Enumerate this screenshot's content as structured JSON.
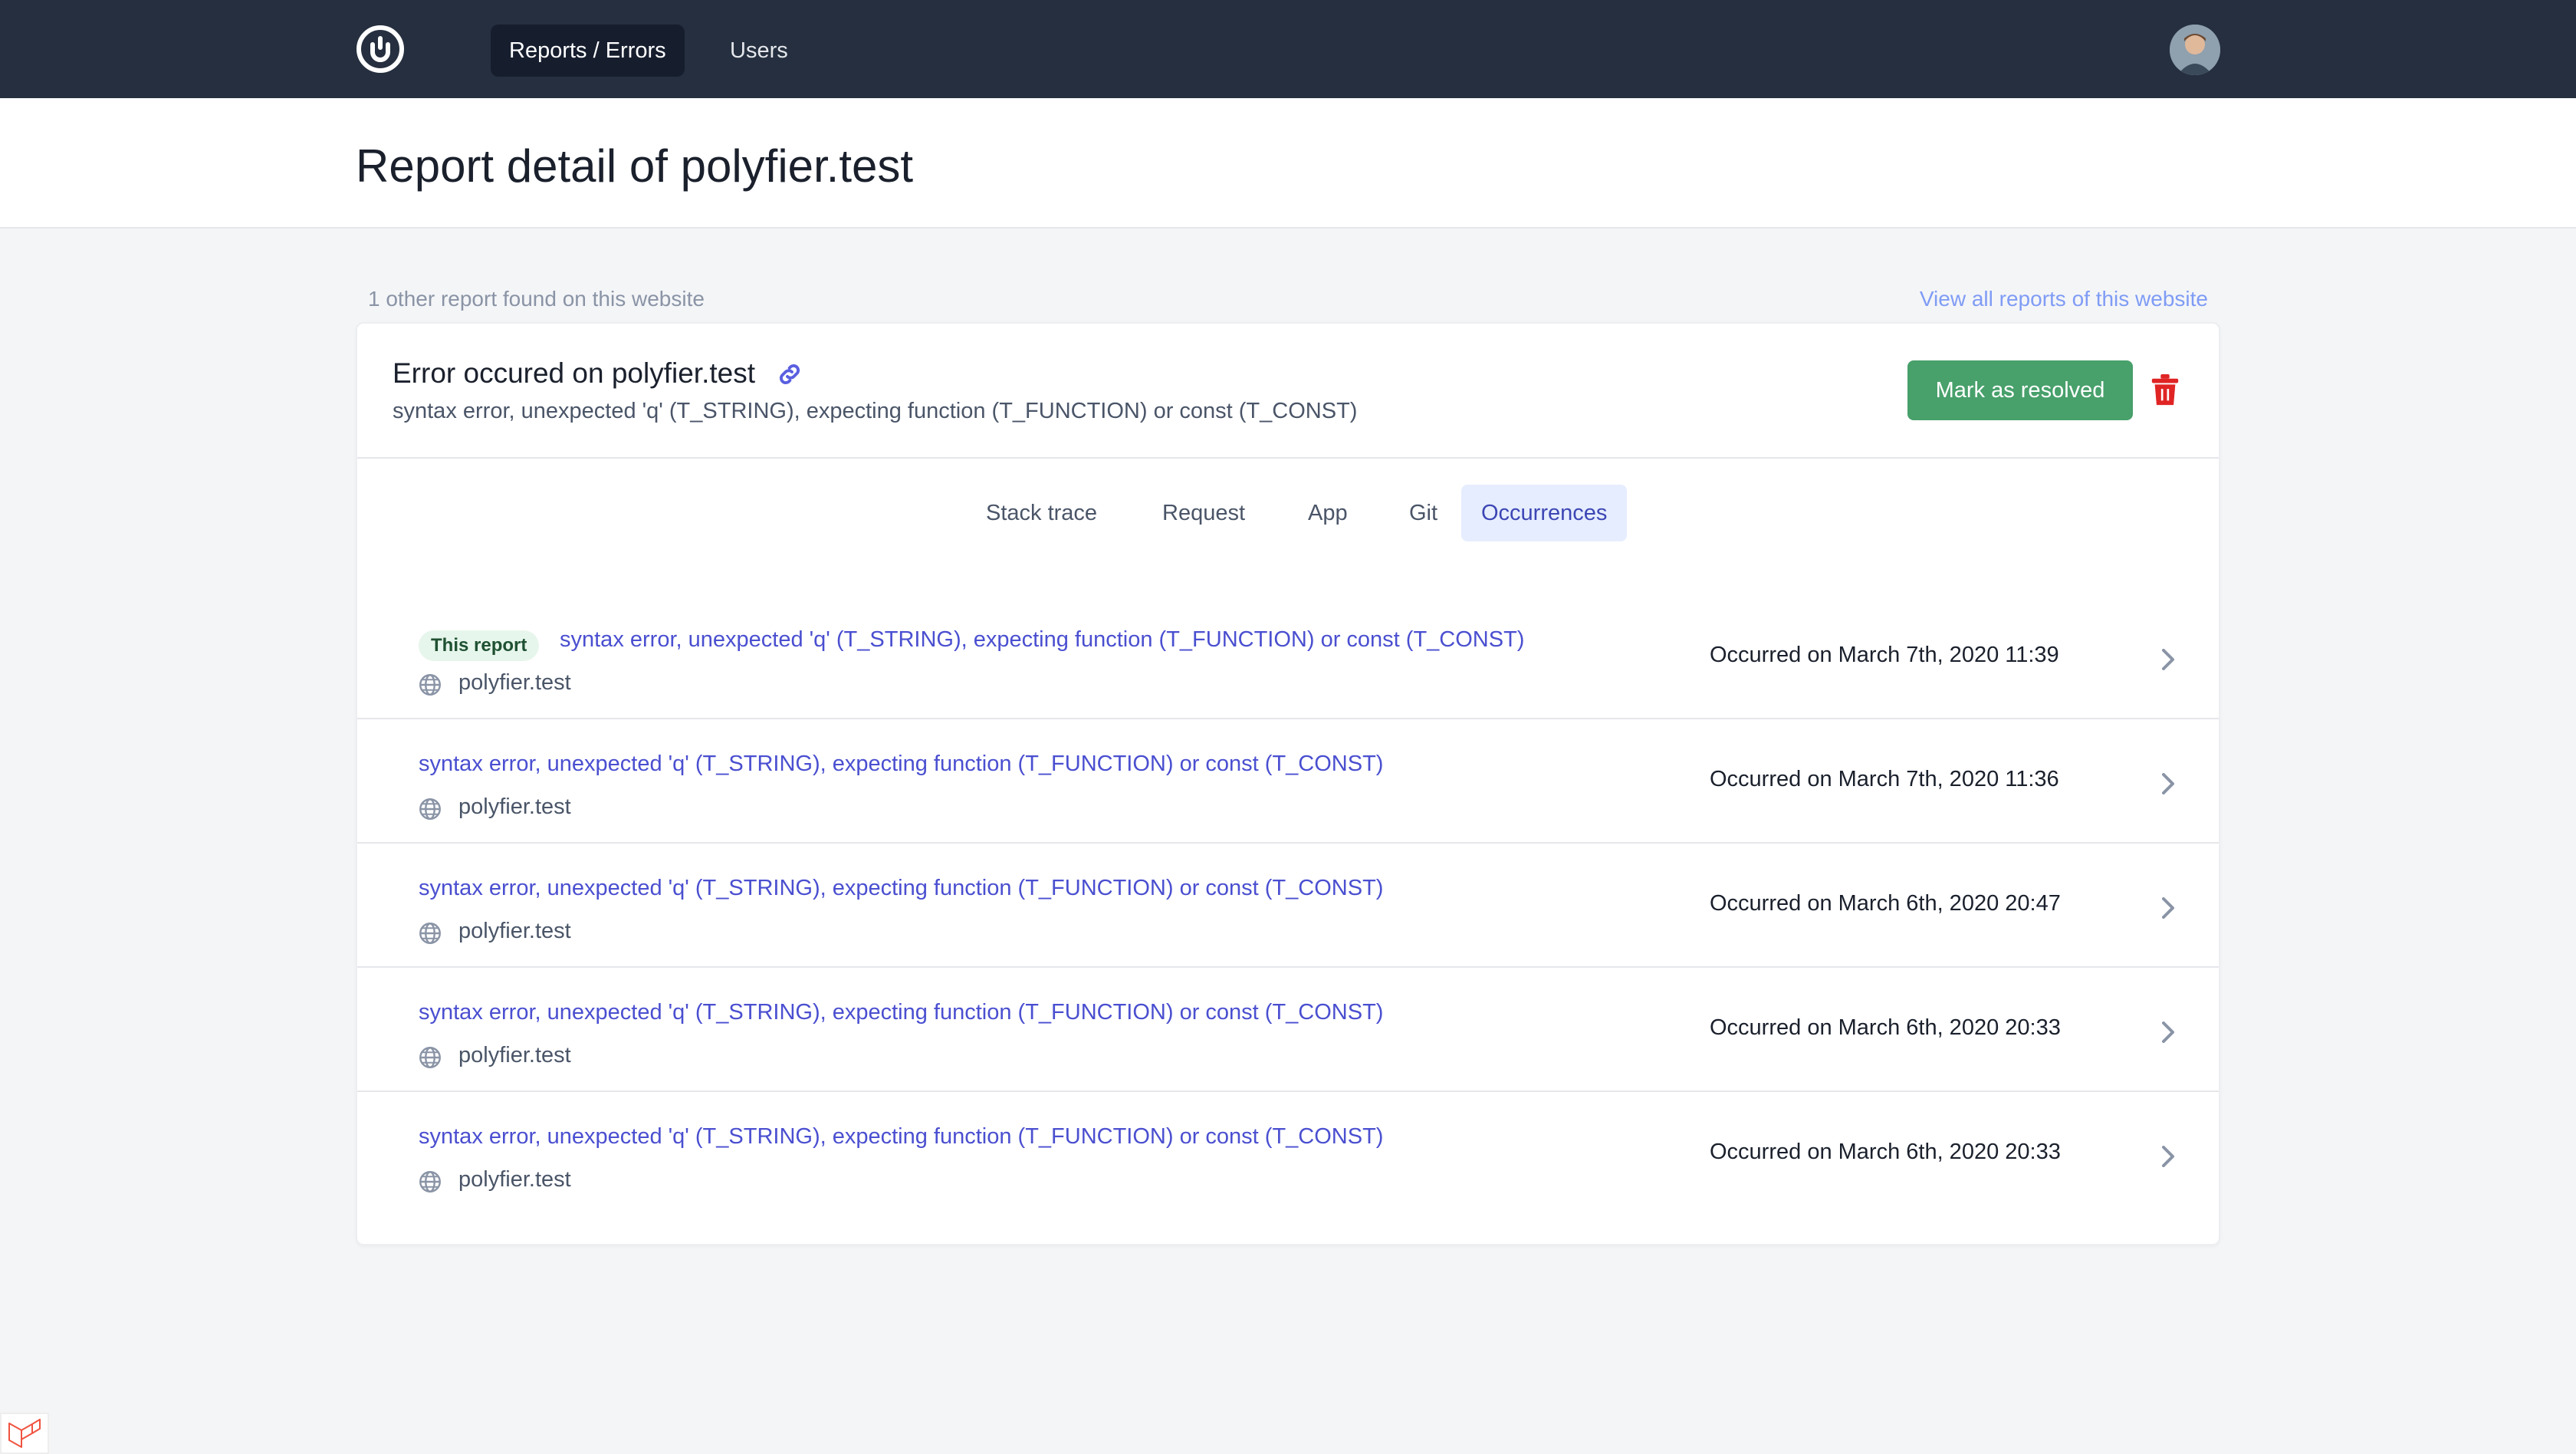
{
  "nav": {
    "items": [
      {
        "label": "Reports / Errors",
        "active": true
      },
      {
        "label": "Users",
        "active": false
      }
    ]
  },
  "header": {
    "title": "Report detail of polyfier.test"
  },
  "info": {
    "other_reports": "1 other report found on this website",
    "view_all": "View all reports of this website"
  },
  "card": {
    "title": "Error occured on polyfier.test",
    "message": "syntax error, unexpected 'q' (T_STRING), expecting function (T_FUNCTION) or const (T_CONST)",
    "resolve_label": "Mark as resolved"
  },
  "tabs": [
    "Stack trace",
    "Request",
    "App",
    "Git",
    "Occurrences"
  ],
  "active_tab": "Occurrences",
  "occurrences": [
    {
      "badge": "This report",
      "message": "syntax error, unexpected 'q' (T_STRING), expecting function (T_FUNCTION) or const (T_CONST)",
      "site": "polyfier.test",
      "date": "Occurred on March 7th, 2020 11:39"
    },
    {
      "badge": "",
      "message": "syntax error, unexpected 'q' (T_STRING), expecting function (T_FUNCTION) or const (T_CONST)",
      "site": "polyfier.test",
      "date": "Occurred on March 7th, 2020 11:36"
    },
    {
      "badge": "",
      "message": "syntax error, unexpected 'q' (T_STRING), expecting function (T_FUNCTION) or const (T_CONST)",
      "site": "polyfier.test",
      "date": "Occurred on March 6th, 2020 20:47"
    },
    {
      "badge": "",
      "message": "syntax error, unexpected 'q' (T_STRING), expecting function (T_FUNCTION) or const (T_CONST)",
      "site": "polyfier.test",
      "date": "Occurred on March 6th, 2020 20:33"
    },
    {
      "badge": "",
      "message": "syntax error, unexpected 'q' (T_STRING), expecting function (T_FUNCTION) or const (T_CONST)",
      "site": "polyfier.test",
      "date": "Occurred on March 6th, 2020 20:33"
    }
  ],
  "colors": {
    "nav_bg": "#252f3f",
    "accent_link": "#4a4fd0",
    "resolve_green": "#48a06b",
    "delete_red": "#e02424"
  },
  "icons": [
    "logo-icon",
    "avatar",
    "link-icon",
    "trash-icon",
    "globe-icon",
    "chevron-right-icon",
    "laravel-icon"
  ]
}
